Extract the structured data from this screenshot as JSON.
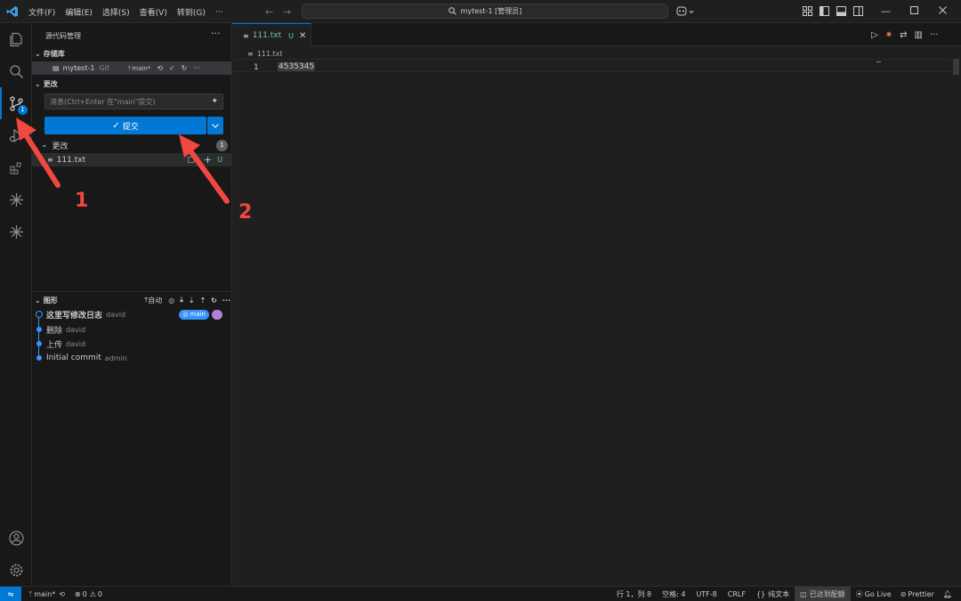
{
  "titlebar": {
    "menus": [
      "文件(F)",
      "编辑(E)",
      "选择(S)",
      "查看(V)",
      "转到(G)",
      "···"
    ],
    "search_text": "mytest-1 [管理员]"
  },
  "activity": {
    "badge": "1"
  },
  "sidebar": {
    "title": "源代码管理",
    "repos_header": "存储库",
    "repo": {
      "name": "mytest-1",
      "type": "Git",
      "branch": "main*"
    },
    "changes_header": "更改",
    "commit_placeholder": "消息(Ctrl+Enter 在\"main\"提交)",
    "commit_label": "提交",
    "changes_group": "更改",
    "changes_count": "1",
    "file": {
      "name": "111.txt",
      "status": "U"
    },
    "graph_header": "图形",
    "graph_auto": "自动",
    "commits": [
      {
        "message": "这里写修改日志",
        "author": "david",
        "ref": "main"
      },
      {
        "message": "删除",
        "author": "david"
      },
      {
        "message": "上传",
        "author": "david"
      },
      {
        "message": "Initial commit",
        "author": "admin"
      }
    ]
  },
  "editor": {
    "tab": {
      "name": "111.txt",
      "status": "U"
    },
    "breadcrumb": "111.txt",
    "lines": [
      {
        "number": "1",
        "text": "4535345"
      }
    ]
  },
  "annotations": {
    "arrow1": "1",
    "arrow2": "2"
  },
  "statusbar": {
    "branch": "main*",
    "errors": "0",
    "warnings": "0",
    "position": "行 1，列 8",
    "spaces": "空格: 4",
    "encoding": "UTF-8",
    "eol": "CRLF",
    "language": "纯文本",
    "quota": "已达到配额",
    "golive": "Go Live",
    "prettier": "Prettier"
  },
  "colors": {
    "accent": "#0078d4",
    "annotation": "#f0473f",
    "untracked": "#73c991"
  }
}
